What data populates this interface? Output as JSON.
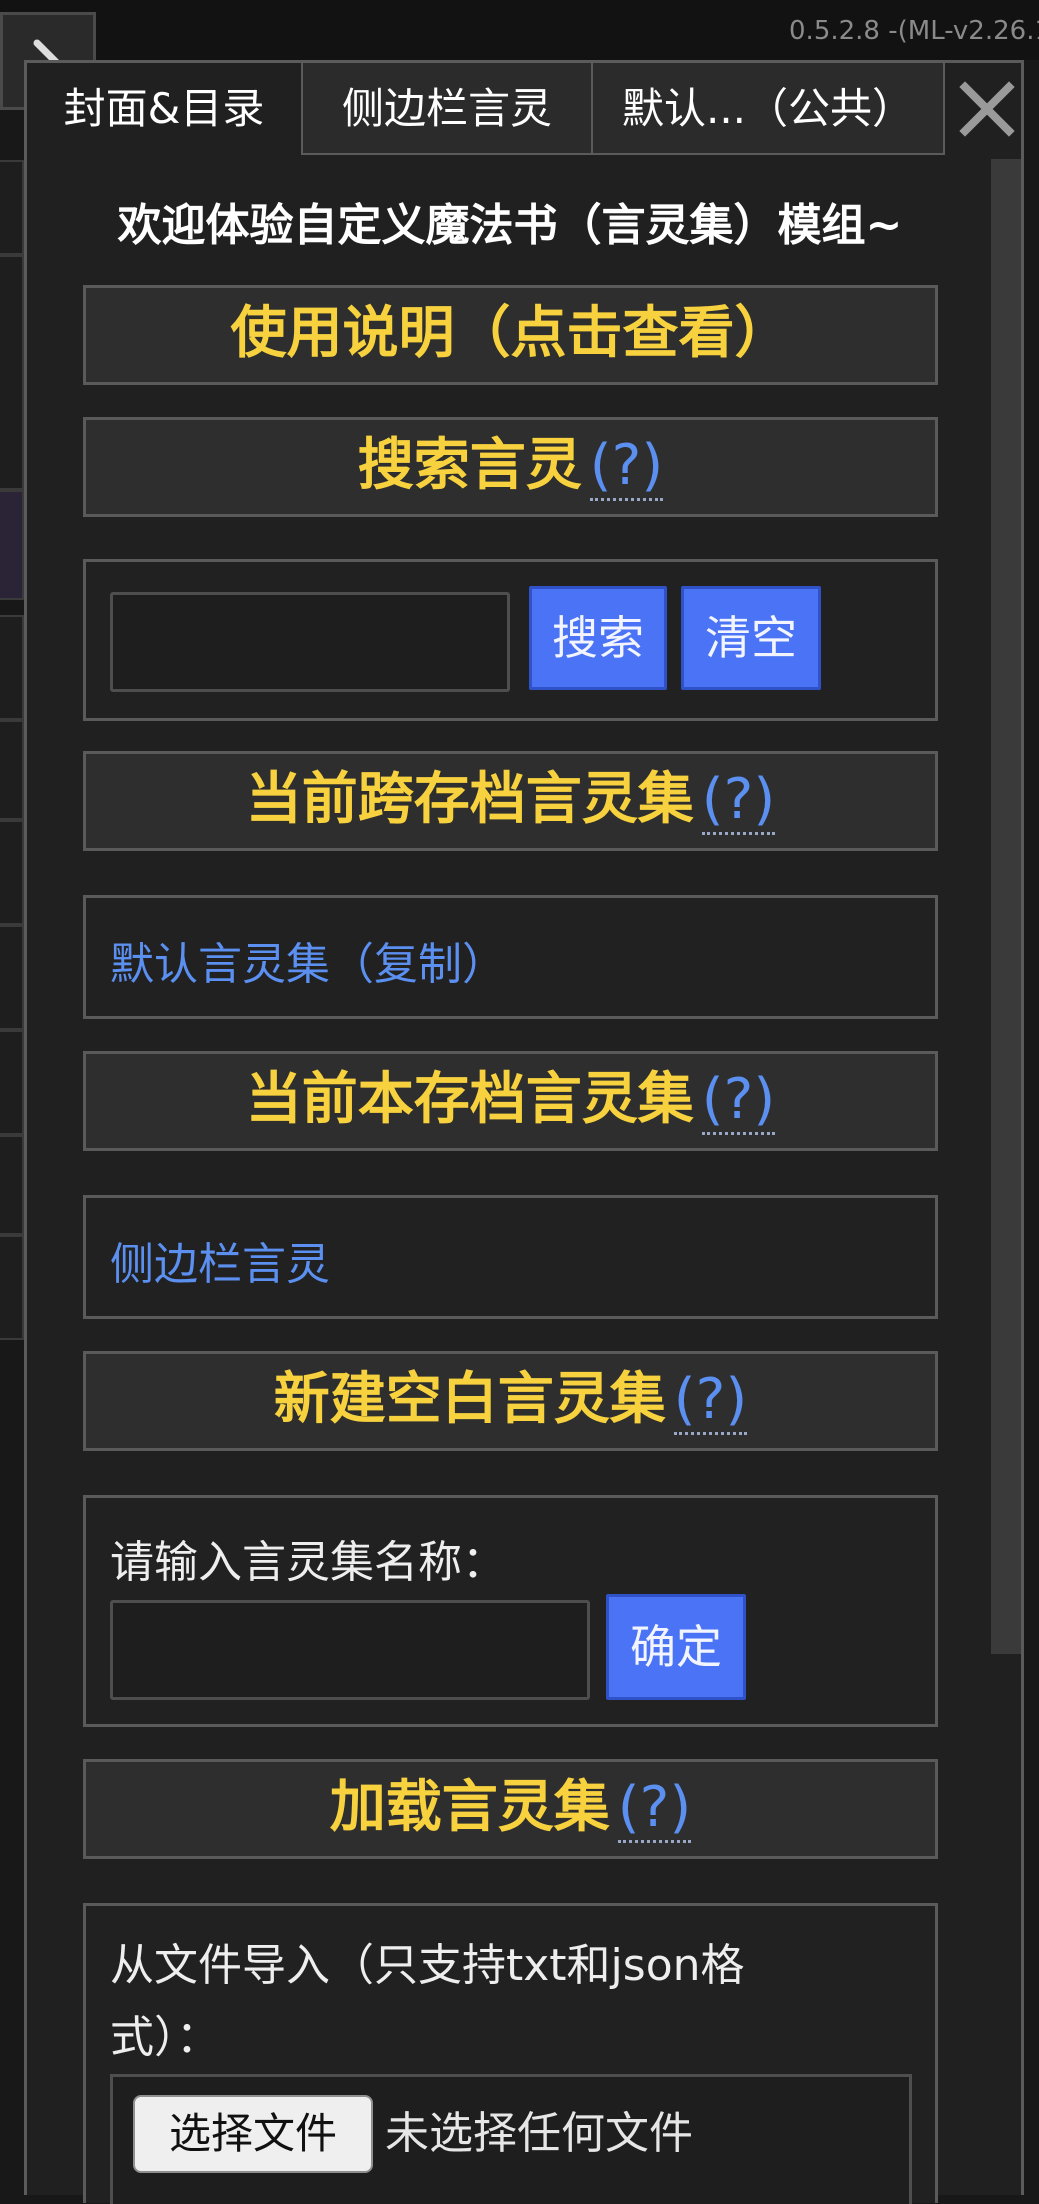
{
  "version_text": "0.5.2.8 -(ML-v2.26.1",
  "tabs": [
    {
      "label": "封面&目录",
      "active": true
    },
    {
      "label": "侧边栏言灵",
      "active": false
    },
    {
      "label": "默认...（公共）",
      "active": false
    }
  ],
  "welcome": "欢迎体验自定义魔法书（言灵集）模组~",
  "help_mark": "(?)",
  "sections": {
    "usage": "使用说明（点击查看）",
    "search": "搜索言灵",
    "cross_save": "当前跨存档言灵集",
    "this_save": "当前本存档言灵集",
    "new_blank": "新建空白言灵集",
    "load": "加载言灵集"
  },
  "search": {
    "input_value": "",
    "search_button": "搜索",
    "clear_button": "清空"
  },
  "cross_save_items": [
    "默认言灵集（复制）"
  ],
  "this_save_items": [
    "侧边栏言灵"
  ],
  "new_set": {
    "prompt": "请输入言灵集名称：",
    "input_value": "",
    "confirm_button": "确定"
  },
  "load": {
    "prompt": "从文件导入（只支持txt和json格式）：",
    "choose_file_button": "选择文件",
    "file_status": "未选择任何文件"
  },
  "colors": {
    "accent_yellow": "#f7d23e",
    "link_blue": "#5b8ff0",
    "button_blue": "#4a74f5",
    "panel_bg": "#202020"
  }
}
